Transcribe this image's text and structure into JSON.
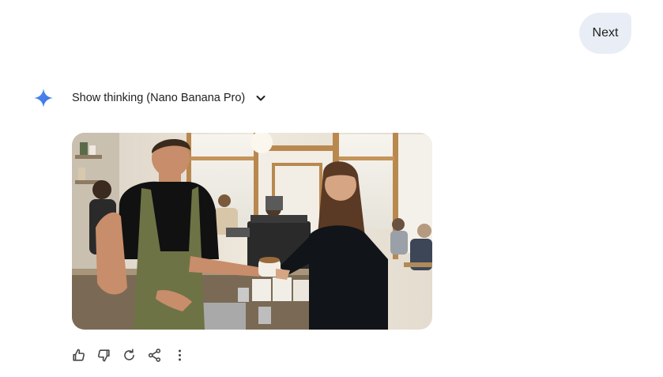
{
  "conversation": {
    "user_message": "Next",
    "response": {
      "thinking_toggle_label": "Show thinking (Nano Banana Pro)",
      "image": {
        "subject": "barista handing a cup of coffee to a smiling customer at a cafe counter"
      },
      "actions": [
        {
          "name": "thumbs-up-icon"
        },
        {
          "name": "thumbs-down-icon"
        },
        {
          "name": "regenerate-icon"
        },
        {
          "name": "share-icon"
        },
        {
          "name": "more-options-icon"
        }
      ]
    }
  },
  "colors": {
    "user_bubble": "#e9eef6",
    "accent": "#4285f4",
    "text": "#1f1f1f",
    "icon": "#444746"
  }
}
